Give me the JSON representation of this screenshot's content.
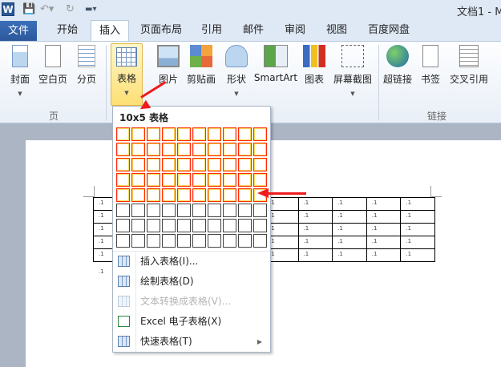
{
  "titlebar": {
    "app_icon": "W",
    "title": "文档1 - M",
    "quick_access": [
      "save-icon",
      "undo-icon",
      "redo-icon",
      "customize-icon"
    ]
  },
  "tabs": [
    "文件",
    "开始",
    "插入",
    "页面布局",
    "引用",
    "邮件",
    "审阅",
    "视图",
    "百度网盘"
  ],
  "active_tab": "插入",
  "ribbon": {
    "groups": [
      {
        "label": "页"
      },
      {
        "label": "链接"
      }
    ],
    "buttons": [
      "封面",
      "空白页",
      "分页",
      "表格",
      "图片",
      "剪贴画",
      "形状",
      "SmartArt",
      "图表",
      "屏幕截图",
      "超链接",
      "书签",
      "交叉引用"
    ]
  },
  "table_menu": {
    "title": "10x5 表格",
    "grid_cols": 10,
    "grid_rows": 8,
    "selected_cols": 10,
    "selected_rows": 5,
    "items": [
      {
        "label": "插入表格(I)...",
        "enabled": true,
        "icon": "table-icon"
      },
      {
        "label": "绘制表格(D)",
        "enabled": true,
        "icon": "draw-table-icon"
      },
      {
        "label": "文本转换成表格(V)...",
        "enabled": false,
        "icon": "text-to-table-icon"
      },
      {
        "label": "Excel 电子表格(X)",
        "enabled": true,
        "icon": "excel-icon"
      },
      {
        "label": "快速表格(T)",
        "enabled": true,
        "icon": "quick-table-icon",
        "submenu": true
      }
    ]
  },
  "document": {
    "table_rows": 5,
    "table_cols": 10,
    "cell_mark": ".1"
  },
  "colors": {
    "selection_border": "#ff2a00",
    "annotation_arrow": "#ee1c1c",
    "file_tab": "#2a5699"
  }
}
